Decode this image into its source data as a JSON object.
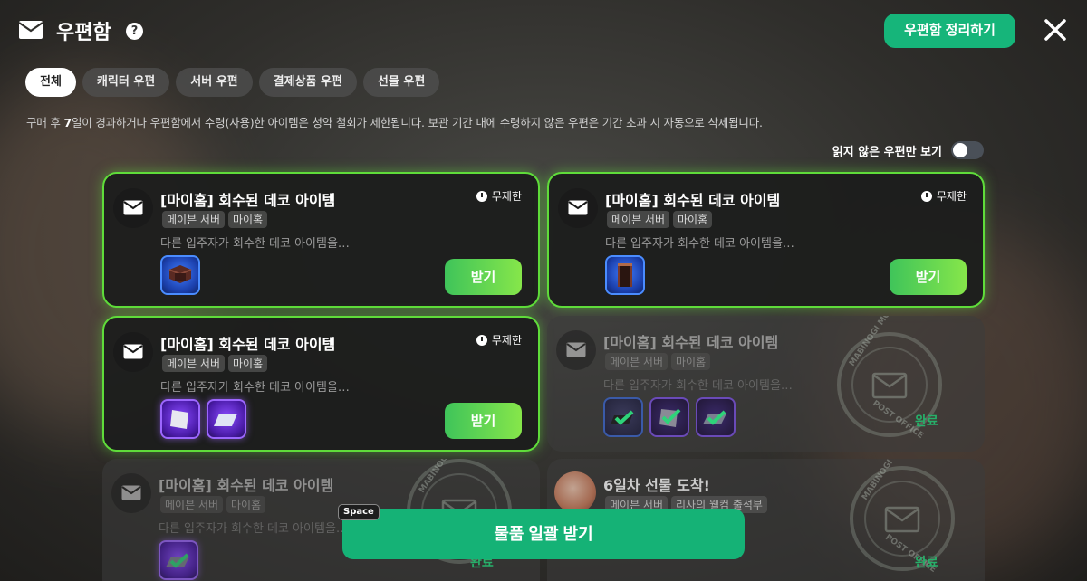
{
  "header": {
    "title": "우편함",
    "organize_label": "우편함 정리하기"
  },
  "tabs": [
    {
      "label": "전체",
      "active": true
    },
    {
      "label": "캐릭터 우편",
      "active": false
    },
    {
      "label": "서버 우편",
      "active": false
    },
    {
      "label": "결제상품 우편",
      "active": false
    },
    {
      "label": "선물 우편",
      "active": false
    }
  ],
  "notice": {
    "pre": "구매 후 ",
    "days": "7",
    "post": "일이 경과하거나 우편함에서 수령(사용)한 아이템은 청약 철회가 제한됩니다. 보관 기간 내에 수령하지 않은 우편은 기간 초과 시 자동으로 삭제됩니다."
  },
  "filter": {
    "unread_only_label": "읽지 않은 우편만 보기",
    "unread_only": false
  },
  "cards": [
    {
      "title": "[마이홈] 회수된 데코 아이템",
      "tags": [
        "메이븐 서버",
        "마이홈"
      ],
      "desc": "다른 입주자가 회수한 데코 아이템을…",
      "expiry": "무제한",
      "action": "받기",
      "status": "unread"
    },
    {
      "title": "[마이홈] 회수된 데코 아이템",
      "tags": [
        "메이븐 서버",
        "마이홈"
      ],
      "desc": "다른 입주자가 회수한 데코 아이템을…",
      "expiry": "무제한",
      "action": "받기",
      "status": "unread"
    },
    {
      "title": "[마이홈] 회수된 데코 아이템",
      "tags": [
        "메이븐 서버",
        "마이홈"
      ],
      "desc": "다른 입주자가 회수한 데코 아이템을…",
      "expiry": "무제한",
      "action": "받기",
      "status": "unread"
    },
    {
      "title": "[마이홈] 회수된 데코 아이템",
      "tags": [
        "메이븐 서버",
        "마이홈"
      ],
      "desc": "다른 입주자가 회수한 데코 아이템을…",
      "status_label": "완료",
      "status": "done"
    },
    {
      "title": "[마이홈] 회수된 데코 아이템",
      "tags": [
        "메이븐 서버",
        "마이홈"
      ],
      "desc": "다른 입주자가 회수한 데코 아이템을…",
      "status_label": "완료",
      "status": "done"
    },
    {
      "title": "6일차 선물 도착!",
      "tags": [
        "메이븐 서버",
        "리사의 웰컴 출석부"
      ],
      "status_label": "완료",
      "status": "done"
    }
  ],
  "stamp": {
    "top": "MABINOGI MOBILE",
    "bottom": "POST OFFICE"
  },
  "footer": {
    "bulk_receive_label": "물품 일괄 받기",
    "shortcut_key": "Space"
  },
  "colors": {
    "accent": "#15b276",
    "receive": "#5fd44a",
    "glow": "#5fdc3a"
  }
}
